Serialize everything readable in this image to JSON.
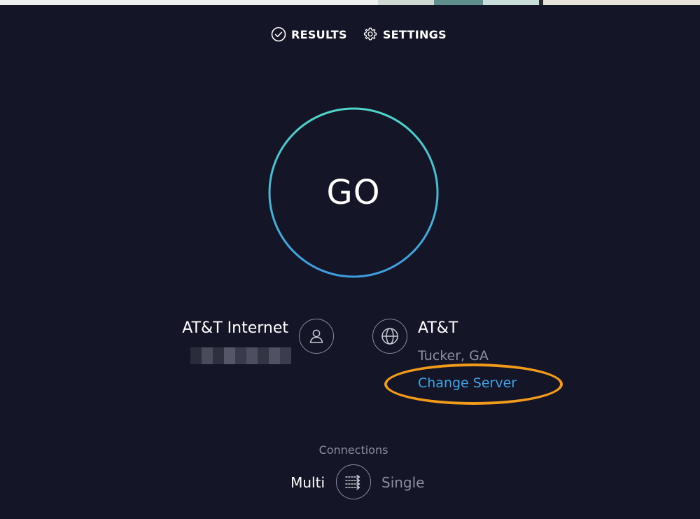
{
  "nav": {
    "results_label": "RESULTS",
    "settings_label": "SETTINGS",
    "results_icon": "check-circle-icon",
    "settings_icon": "gear-icon"
  },
  "go_button": {
    "label": "GO",
    "ring_colors": [
      "#4fd6c8",
      "#3f9be0"
    ]
  },
  "isp": {
    "name": "AT&T Internet",
    "icon": "user-icon",
    "ip_redacted": true
  },
  "server": {
    "name": "AT&T",
    "location": "Tucker, GA",
    "change_label": "Change Server",
    "icon": "globe-icon",
    "link_color": "#3ea5e8"
  },
  "annotation": {
    "highlight_color": "#f29a1a"
  },
  "connections": {
    "label": "Connections",
    "multi_label": "Multi",
    "single_label": "Single",
    "selected": "Multi",
    "toggle_icon": "connections-toggle-icon"
  }
}
